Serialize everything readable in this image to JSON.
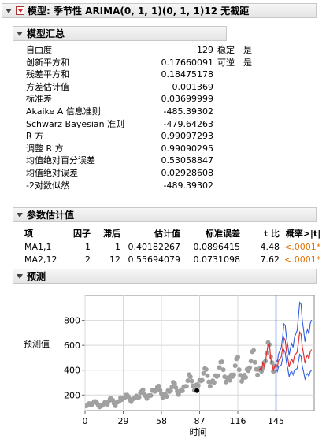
{
  "title": "模型: 季节性 ARIMA(0, 1, 1)(0, 1, 1)12 无截距",
  "summary": {
    "title": "模型汇总",
    "rows": [
      {
        "label": "自由度",
        "value": "129",
        "x1": "稳定",
        "x2": "是"
      },
      {
        "label": "创新平方和",
        "value": "0.17660091",
        "x1": "可逆",
        "x2": "是"
      },
      {
        "label": "残差平方和",
        "value": "0.18475178"
      },
      {
        "label": "方差估计值",
        "value": "0.001369"
      },
      {
        "label": "标准差",
        "value": "0.03699999"
      },
      {
        "label": "Akaike A 信息准则",
        "value": "-485.39302"
      },
      {
        "label": "Schwarz Bayesian 准则",
        "value": "-479.64263"
      },
      {
        "label": "R 方",
        "value": "0.99097293"
      },
      {
        "label": "调整 R 方",
        "value": "0.99090295"
      },
      {
        "label": "均值绝对百分误差",
        "value": "0.53058847"
      },
      {
        "label": "均值绝对误差",
        "value": "0.02928608"
      },
      {
        "label": "-2对数似然",
        "value": "-489.39302"
      }
    ]
  },
  "params": {
    "title": "参数估计值",
    "headers": [
      "项",
      "因子",
      "滞后",
      "估计值",
      "标准误差",
      "t 比",
      "概率>|t|"
    ],
    "rows": [
      [
        "MA1,1",
        "1",
        "1",
        "0.40182267",
        "0.0896415",
        "4.48",
        "<.0001*"
      ],
      [
        "MA2,12",
        "2",
        "12",
        "0.55694079",
        "0.0731098",
        "7.62",
        "<.0001*"
      ]
    ]
  },
  "forecast": {
    "title": "预测"
  },
  "colors": {
    "accent": "#e07000",
    "forecast_line": "#e03030",
    "ci_line": "#2f5fe0",
    "points": "#a0a0a0"
  },
  "chart_data": {
    "type": "scatter",
    "xlabel": "时间",
    "ylabel": "预测值",
    "xticks": [
      0,
      29,
      58,
      87,
      116,
      145
    ],
    "yticks": [
      200,
      400,
      600,
      800
    ],
    "xlim": [
      0,
      174
    ],
    "ylim": [
      75,
      1000
    ],
    "forecast_origin": 145,
    "highlight_point": [
      85,
      235
    ],
    "observed": [
      [
        1,
        112
      ],
      [
        2,
        118
      ],
      [
        3,
        132
      ],
      [
        4,
        129
      ],
      [
        5,
        121
      ],
      [
        6,
        135
      ],
      [
        7,
        148
      ],
      [
        8,
        148
      ],
      [
        9,
        136
      ],
      [
        10,
        119
      ],
      [
        11,
        104
      ],
      [
        12,
        118
      ],
      [
        13,
        115
      ],
      [
        14,
        126
      ],
      [
        15,
        141
      ],
      [
        16,
        135
      ],
      [
        17,
        125
      ],
      [
        18,
        149
      ],
      [
        19,
        170
      ],
      [
        20,
        170
      ],
      [
        21,
        158
      ],
      [
        22,
        133
      ],
      [
        23,
        114
      ],
      [
        24,
        140
      ],
      [
        25,
        145
      ],
      [
        26,
        150
      ],
      [
        27,
        178
      ],
      [
        28,
        163
      ],
      [
        29,
        172
      ],
      [
        30,
        178
      ],
      [
        31,
        199
      ],
      [
        32,
        199
      ],
      [
        33,
        184
      ],
      [
        34,
        162
      ],
      [
        35,
        146
      ],
      [
        36,
        166
      ],
      [
        37,
        171
      ],
      [
        38,
        180
      ],
      [
        39,
        193
      ],
      [
        40,
        181
      ],
      [
        41,
        183
      ],
      [
        42,
        218
      ],
      [
        43,
        230
      ],
      [
        44,
        242
      ],
      [
        45,
        209
      ],
      [
        46,
        191
      ],
      [
        47,
        172
      ],
      [
        48,
        194
      ],
      [
        49,
        196
      ],
      [
        50,
        196
      ],
      [
        51,
        236
      ],
      [
        52,
        235
      ],
      [
        53,
        229
      ],
      [
        54,
        243
      ],
      [
        55,
        264
      ],
      [
        56,
        272
      ],
      [
        57,
        237
      ],
      [
        58,
        211
      ],
      [
        59,
        180
      ],
      [
        60,
        201
      ],
      [
        61,
        204
      ],
      [
        62,
        188
      ],
      [
        63,
        235
      ],
      [
        64,
        227
      ],
      [
        65,
        234
      ],
      [
        66,
        264
      ],
      [
        67,
        302
      ],
      [
        68,
        293
      ],
      [
        69,
        259
      ],
      [
        70,
        229
      ],
      [
        71,
        203
      ],
      [
        72,
        229
      ],
      [
        73,
        242
      ],
      [
        74,
        233
      ],
      [
        75,
        267
      ],
      [
        76,
        269
      ],
      [
        77,
        270
      ],
      [
        78,
        315
      ],
      [
        79,
        364
      ],
      [
        80,
        347
      ],
      [
        81,
        312
      ],
      [
        82,
        274
      ],
      [
        83,
        237
      ],
      [
        84,
        278
      ],
      [
        85,
        284
      ],
      [
        86,
        277
      ],
      [
        87,
        317
      ],
      [
        88,
        313
      ],
      [
        89,
        318
      ],
      [
        90,
        374
      ],
      [
        91,
        413
      ],
      [
        92,
        405
      ],
      [
        93,
        355
      ],
      [
        94,
        306
      ],
      [
        95,
        271
      ],
      [
        96,
        306
      ],
      [
        97,
        315
      ],
      [
        98,
        301
      ],
      [
        99,
        356
      ],
      [
        100,
        348
      ],
      [
        101,
        355
      ],
      [
        102,
        422
      ],
      [
        103,
        465
      ],
      [
        104,
        467
      ],
      [
        105,
        404
      ],
      [
        106,
        347
      ],
      [
        107,
        305
      ],
      [
        108,
        336
      ],
      [
        109,
        340
      ],
      [
        110,
        318
      ],
      [
        111,
        362
      ],
      [
        112,
        348
      ],
      [
        113,
        363
      ],
      [
        114,
        435
      ],
      [
        115,
        491
      ],
      [
        116,
        505
      ],
      [
        117,
        404
      ],
      [
        118,
        359
      ],
      [
        119,
        310
      ],
      [
        120,
        337
      ],
      [
        121,
        360
      ],
      [
        122,
        342
      ],
      [
        123,
        406
      ],
      [
        124,
        396
      ],
      [
        125,
        420
      ],
      [
        126,
        472
      ],
      [
        127,
        548
      ],
      [
        128,
        559
      ],
      [
        129,
        463
      ],
      [
        130,
        407
      ],
      [
        131,
        362
      ],
      [
        132,
        405
      ],
      [
        133,
        417
      ],
      [
        134,
        391
      ],
      [
        135,
        419
      ],
      [
        136,
        461
      ],
      [
        137,
        472
      ],
      [
        138,
        535
      ],
      [
        139,
        622
      ],
      [
        140,
        606
      ],
      [
        141,
        508
      ],
      [
        142,
        461
      ],
      [
        143,
        390
      ],
      [
        144,
        432
      ]
    ],
    "forecast": [
      [
        132,
        396
      ],
      [
        133,
        414
      ],
      [
        134,
        397
      ],
      [
        135,
        458
      ],
      [
        136,
        430
      ],
      [
        137,
        471
      ],
      [
        138,
        540
      ],
      [
        139,
        606
      ],
      [
        140,
        614
      ],
      [
        141,
        493
      ],
      [
        142,
        446
      ],
      [
        143,
        398
      ],
      [
        144,
        427
      ],
      [
        145,
        450
      ],
      [
        146,
        426
      ],
      [
        147,
        477
      ],
      [
        148,
        493
      ],
      [
        149,
        507
      ],
      [
        150,
        575
      ],
      [
        151,
        659
      ],
      [
        152,
        643
      ],
      [
        153,
        548
      ],
      [
        154,
        492
      ],
      [
        155,
        424
      ],
      [
        156,
        470
      ],
      [
        157,
        488
      ],
      [
        158,
        460
      ],
      [
        159,
        513
      ],
      [
        160,
        530
      ],
      [
        161,
        544
      ],
      [
        162,
        617
      ],
      [
        163,
        706
      ],
      [
        164,
        689
      ],
      [
        165,
        587
      ],
      [
        166,
        527
      ],
      [
        167,
        455
      ],
      [
        168,
        503
      ],
      [
        169,
        521
      ],
      [
        170,
        491
      ],
      [
        171,
        548
      ],
      [
        172,
        566
      ]
    ],
    "upper_ci": [
      [
        145,
        483
      ],
      [
        146,
        467
      ],
      [
        147,
        531
      ],
      [
        148,
        558
      ],
      [
        149,
        581
      ],
      [
        150,
        666
      ],
      [
        151,
        772
      ],
      [
        152,
        762
      ],
      [
        153,
        656
      ],
      [
        154,
        595
      ],
      [
        155,
        517
      ],
      [
        156,
        580
      ],
      [
        157,
        614
      ],
      [
        158,
        584
      ],
      [
        159,
        660
      ],
      [
        160,
        690
      ],
      [
        161,
        718
      ],
      [
        162,
        820
      ],
      [
        163,
        945
      ],
      [
        164,
        930
      ],
      [
        165,
        798
      ],
      [
        166,
        722
      ],
      [
        167,
        628
      ],
      [
        168,
        698
      ],
      [
        169,
        728
      ],
      [
        170,
        690
      ],
      [
        171,
        773
      ],
      [
        172,
        803
      ]
    ],
    "lower_ci": [
      [
        145,
        419
      ],
      [
        146,
        389
      ],
      [
        147,
        429
      ],
      [
        148,
        435
      ],
      [
        149,
        442
      ],
      [
        150,
        496
      ],
      [
        151,
        563
      ],
      [
        152,
        542
      ],
      [
        153,
        458
      ],
      [
        154,
        407
      ],
      [
        155,
        348
      ],
      [
        156,
        381
      ],
      [
        157,
        388
      ],
      [
        158,
        362
      ],
      [
        159,
        399
      ],
      [
        160,
        407
      ],
      [
        161,
        412
      ],
      [
        162,
        464
      ],
      [
        163,
        527
      ],
      [
        164,
        510
      ],
      [
        165,
        431
      ],
      [
        166,
        384
      ],
      [
        167,
        329
      ],
      [
        168,
        362
      ],
      [
        169,
        373
      ],
      [
        170,
        349
      ],
      [
        171,
        388
      ],
      [
        172,
        398
      ]
    ]
  }
}
